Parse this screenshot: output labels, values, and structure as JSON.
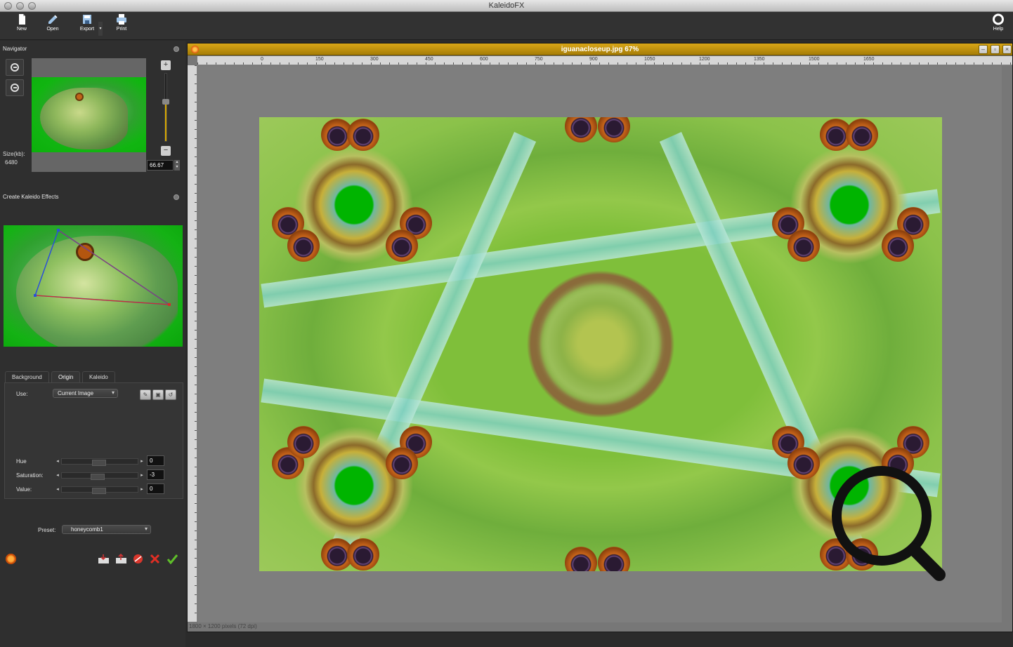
{
  "window": {
    "title": "KaleidoFX"
  },
  "toolbar": {
    "new_label": "New",
    "open_label": "Open",
    "export_label": "Export",
    "print_label": "Print",
    "help_label": "Help"
  },
  "navigator": {
    "heading": "Navigator",
    "size_label": "Size(kb):",
    "size_value": "6480",
    "zoom_value": "66.67",
    "zoom_level": 0.6667
  },
  "kaleido_panel": {
    "heading": "Create Kaleido Effects",
    "tabs": [
      {
        "label": "Background"
      },
      {
        "label": "Origin"
      },
      {
        "label": "Kaleido"
      }
    ],
    "active_tab": "Origin",
    "use_label": "Use:",
    "use_value": "Current Image",
    "hue_label": "Hue",
    "hue_value": "0",
    "saturation_label": "Saturation:",
    "saturation_value": "-3",
    "value_label": "Value:",
    "value_value": "0",
    "preset_label": "Preset:",
    "preset_value": "honeycomb1"
  },
  "document": {
    "title": "iguanacloseup.jpg 67%",
    "status": "1800 × 1200 pixels (72 dpi)",
    "ruler_ticks": [
      "0",
      "150",
      "300",
      "450",
      "600",
      "750",
      "900",
      "1050",
      "1200",
      "1350",
      "1500",
      "1650"
    ]
  },
  "colors": {
    "accent": "#d8a800",
    "title_gold": "#c49311",
    "panel_bg": "#2f2f2f",
    "canvas_bg": "#7e7e7e"
  },
  "icons": {
    "toolbar": [
      "new-file-icon",
      "open-pencil-icon",
      "export-disk-icon",
      "print-icon",
      "help-lifebuoy-icon"
    ],
    "bottom": [
      "flower-icon",
      "import-icon",
      "export-icon",
      "stop-icon",
      "cancel-x-icon",
      "apply-check-icon"
    ]
  }
}
